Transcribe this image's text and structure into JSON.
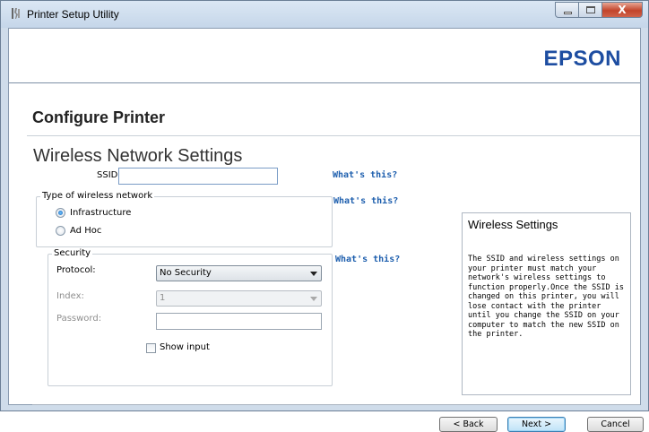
{
  "window": {
    "title": "Printer Setup Utility",
    "icon": "printer-tool-icon",
    "minimize_glyph": "",
    "maximize_glyph": "",
    "close_glyph": "X"
  },
  "header": {
    "brand": "EPSON",
    "brand_color": "#1d4da1"
  },
  "page": {
    "title": "Configure Printer",
    "section_title": "Wireless Network Settings"
  },
  "ssid": {
    "label": "SSID:",
    "value": "",
    "help_link": "What's this?"
  },
  "network_type": {
    "legend": "Type of wireless network",
    "help_link": "What's this?",
    "options": [
      {
        "label": "Infrastructure",
        "checked": true
      },
      {
        "label": "Ad Hoc",
        "checked": false
      }
    ]
  },
  "security": {
    "legend": "Security",
    "help_link": "What's this?",
    "protocol_label": "Protocol:",
    "protocol_value": "No Security",
    "index_label": "Index:",
    "index_value": "1",
    "password_label": "Password:",
    "password_value": "",
    "show_input_label": "Show input",
    "show_input_checked": false
  },
  "info": {
    "title": "Wireless Settings",
    "text": "The SSID and wireless settings on your printer must match your network's wireless settings to function properly.Once the SSID is changed on this printer, you will lose contact with the printer until you change the SSID on your computer to match the new SSID on the printer."
  },
  "footer": {
    "back_label": "< Back",
    "next_label": "Next >",
    "cancel_label": "Cancel"
  },
  "colors": {
    "link": "#1e5fae",
    "window_frame": "#cfdcea"
  }
}
